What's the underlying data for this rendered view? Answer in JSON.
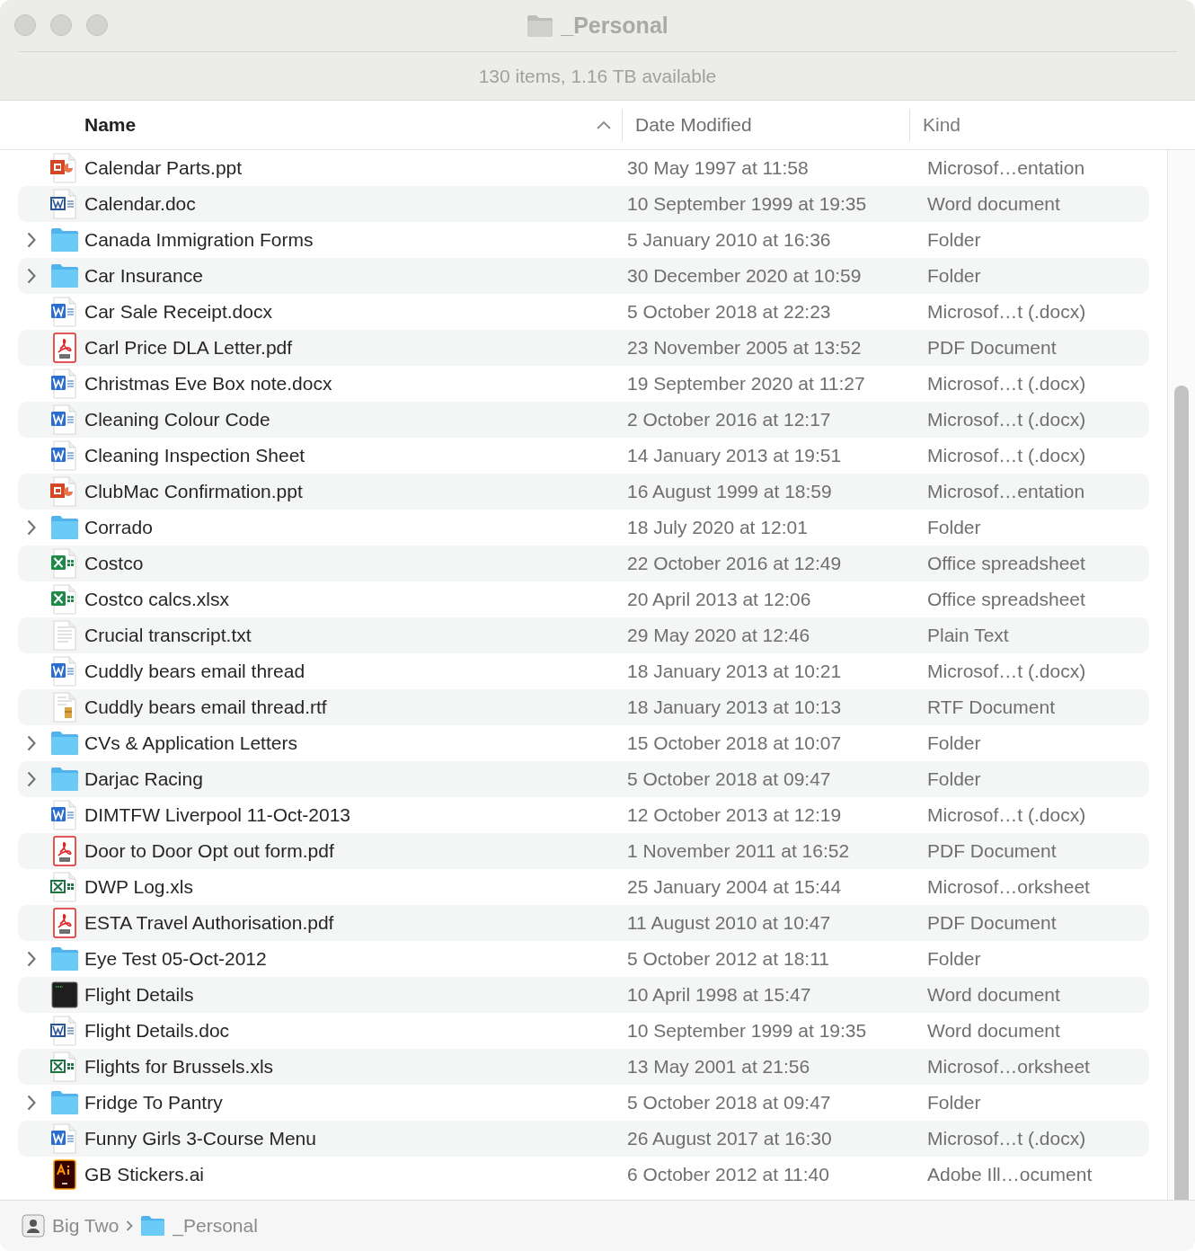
{
  "window": {
    "title": "_Personal",
    "subtitle": "130 items, 1.16 TB available"
  },
  "columns": [
    {
      "label": "Name",
      "sorted": true
    },
    {
      "label": "Date Modified",
      "sorted": false
    },
    {
      "label": "Kind",
      "sorted": false
    }
  ],
  "rows": [
    {
      "kind": "ppt",
      "name": "Calendar Parts.ppt",
      "date_modified": "30 May 1997 at 11:58",
      "file_kind": "Microsof…entation"
    },
    {
      "kind": "doc",
      "name": "Calendar.doc",
      "date_modified": "10 September 1999 at 19:35",
      "file_kind": "Word document"
    },
    {
      "kind": "folder",
      "name": "Canada Immigration Forms",
      "date_modified": "5 January 2010 at 16:36",
      "file_kind": "Folder"
    },
    {
      "kind": "folder",
      "name": "Car Insurance",
      "date_modified": "30 December 2020 at 10:59",
      "file_kind": "Folder"
    },
    {
      "kind": "docx",
      "name": "Car Sale Receipt.docx",
      "date_modified": "5 October 2018 at 22:23",
      "file_kind": "Microsof…t (.docx)"
    },
    {
      "kind": "pdf",
      "name": "Carl Price DLA Letter.pdf",
      "date_modified": "23 November 2005 at 13:52",
      "file_kind": "PDF Document"
    },
    {
      "kind": "docx",
      "name": "Christmas Eve Box note.docx",
      "date_modified": "19 September 2020 at 11:27",
      "file_kind": "Microsof…t (.docx)"
    },
    {
      "kind": "docx",
      "name": "Cleaning Colour Code",
      "date_modified": "2 October 2016 at 12:17",
      "file_kind": "Microsof…t (.docx)"
    },
    {
      "kind": "docx",
      "name": "Cleaning Inspection Sheet",
      "date_modified": "14 January 2013 at 19:51",
      "file_kind": "Microsof…t (.docx)"
    },
    {
      "kind": "ppt",
      "name": "ClubMac Confirmation.ppt",
      "date_modified": "16 August 1999 at 18:59",
      "file_kind": "Microsof…entation"
    },
    {
      "kind": "folder",
      "name": "Corrado",
      "date_modified": "18 July 2020 at 12:01",
      "file_kind": "Folder"
    },
    {
      "kind": "xlsx",
      "name": "Costco",
      "date_modified": "22 October 2016 at 12:49",
      "file_kind": "Office spreadsheet"
    },
    {
      "kind": "xlsx",
      "name": "Costco calcs.xlsx",
      "date_modified": "20 April 2013 at 12:06",
      "file_kind": "Office spreadsheet"
    },
    {
      "kind": "txt",
      "name": "Crucial transcript.txt",
      "date_modified": "29 May 2020 at 12:46",
      "file_kind": "Plain Text"
    },
    {
      "kind": "docx",
      "name": "Cuddly bears email thread",
      "date_modified": "18 January 2013 at 10:21",
      "file_kind": "Microsof…t (.docx)"
    },
    {
      "kind": "rtf",
      "name": "Cuddly bears email thread.rtf",
      "date_modified": "18 January 2013 at 10:13",
      "file_kind": "RTF Document"
    },
    {
      "kind": "folder",
      "name": "CVs & Application Letters",
      "date_modified": "15 October 2018 at 10:07",
      "file_kind": "Folder"
    },
    {
      "kind": "folder",
      "name": "Darjac Racing",
      "date_modified": "5 October 2018 at 09:47",
      "file_kind": "Folder"
    },
    {
      "kind": "docx",
      "name": "DIMTFW Liverpool 11-Oct-2013",
      "date_modified": "12 October 2013 at 12:19",
      "file_kind": "Microsof…t (.docx)"
    },
    {
      "kind": "pdf",
      "name": "Door to Door Opt out form.pdf",
      "date_modified": "1 November 2011 at 16:52",
      "file_kind": "PDF Document"
    },
    {
      "kind": "xls",
      "name": "DWP Log.xls",
      "date_modified": "25 January 2004 at 15:44",
      "file_kind": "Microsof…orksheet"
    },
    {
      "kind": "pdf",
      "name": "ESTA Travel Authorisation.pdf",
      "date_modified": "11 August 2010 at 10:47",
      "file_kind": "PDF Document"
    },
    {
      "kind": "folder",
      "name": "Eye Test 05-Oct-2012",
      "date_modified": "5 October 2012 at 18:11",
      "file_kind": "Folder"
    },
    {
      "kind": "exec",
      "name": "Flight Details",
      "date_modified": "10 April 1998 at 15:47",
      "file_kind": "Word document"
    },
    {
      "kind": "doc",
      "name": "Flight Details.doc",
      "date_modified": "10 September 1999 at 19:35",
      "file_kind": "Word document"
    },
    {
      "kind": "xls",
      "name": "Flights for Brussels.xls",
      "date_modified": "13 May 2001 at 21:56",
      "file_kind": "Microsof…orksheet"
    },
    {
      "kind": "folder",
      "name": "Fridge To Pantry",
      "date_modified": "5 October 2018 at 09:47",
      "file_kind": "Folder"
    },
    {
      "kind": "docx",
      "name": "Funny Girls 3-Course Menu",
      "date_modified": "26 August 2017 at 16:30",
      "file_kind": "Microsof…t (.docx)"
    },
    {
      "kind": "ai",
      "name": "GB Stickers.ai",
      "date_modified": "6 October 2012 at 11:40",
      "file_kind": "Adobe Ill…ocument"
    }
  ],
  "path_bar": [
    {
      "kind": "disk",
      "label": "Big Two"
    },
    {
      "kind": "folder",
      "label": "_Personal"
    }
  ]
}
